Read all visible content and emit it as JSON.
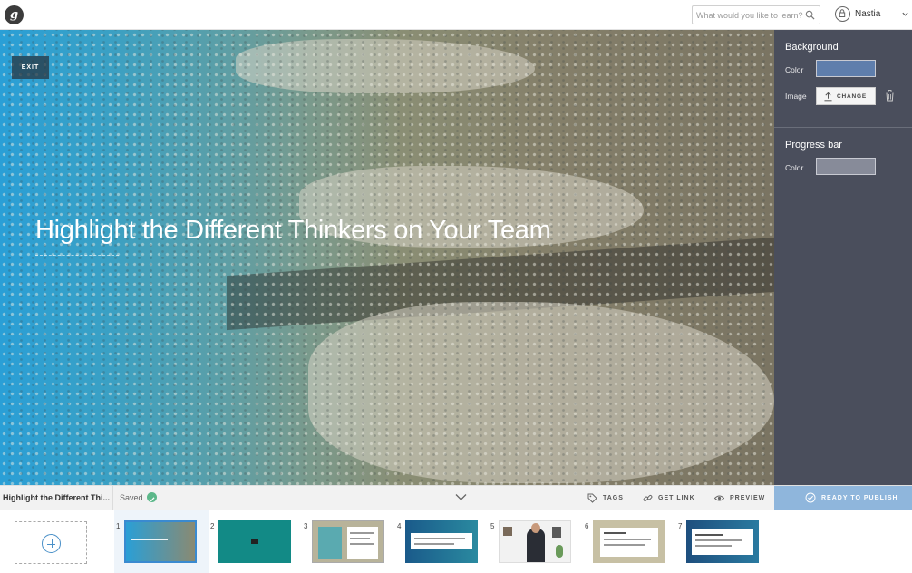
{
  "header": {
    "logo_glyph": "g",
    "search_placeholder": "What would you like to learn?",
    "search_icon": "magnifier-icon",
    "user_name": "Nastia"
  },
  "slide": {
    "title": "Highlight the Different Thinkers on Your Team",
    "exit_label": "EXIT"
  },
  "panel": {
    "background_heading": "Background",
    "color_label": "Color",
    "image_label": "Image",
    "change_label": "CHANGE",
    "background_color": "#5f7eac",
    "progress_heading": "Progress bar",
    "progress_color_label": "Color",
    "progress_color": "#878b99"
  },
  "bottombar": {
    "lesson_title": "Highlight the Different Thi...",
    "saved_label": "Saved",
    "tags_label": "TAGS",
    "get_link_label": "GET LINK",
    "preview_label": "PREVIEW",
    "publish_label": "READY TO PUBLISH"
  },
  "thumbnails": [
    {
      "number": "1"
    },
    {
      "number": "2"
    },
    {
      "number": "3"
    },
    {
      "number": "4"
    },
    {
      "number": "5"
    },
    {
      "number": "6"
    },
    {
      "number": "7"
    }
  ],
  "colors": {
    "accent": "#3a8ad0",
    "publish": "#8fb6dc",
    "panel_bg": "#4a4e5c",
    "saved_check": "#5cb88a"
  }
}
